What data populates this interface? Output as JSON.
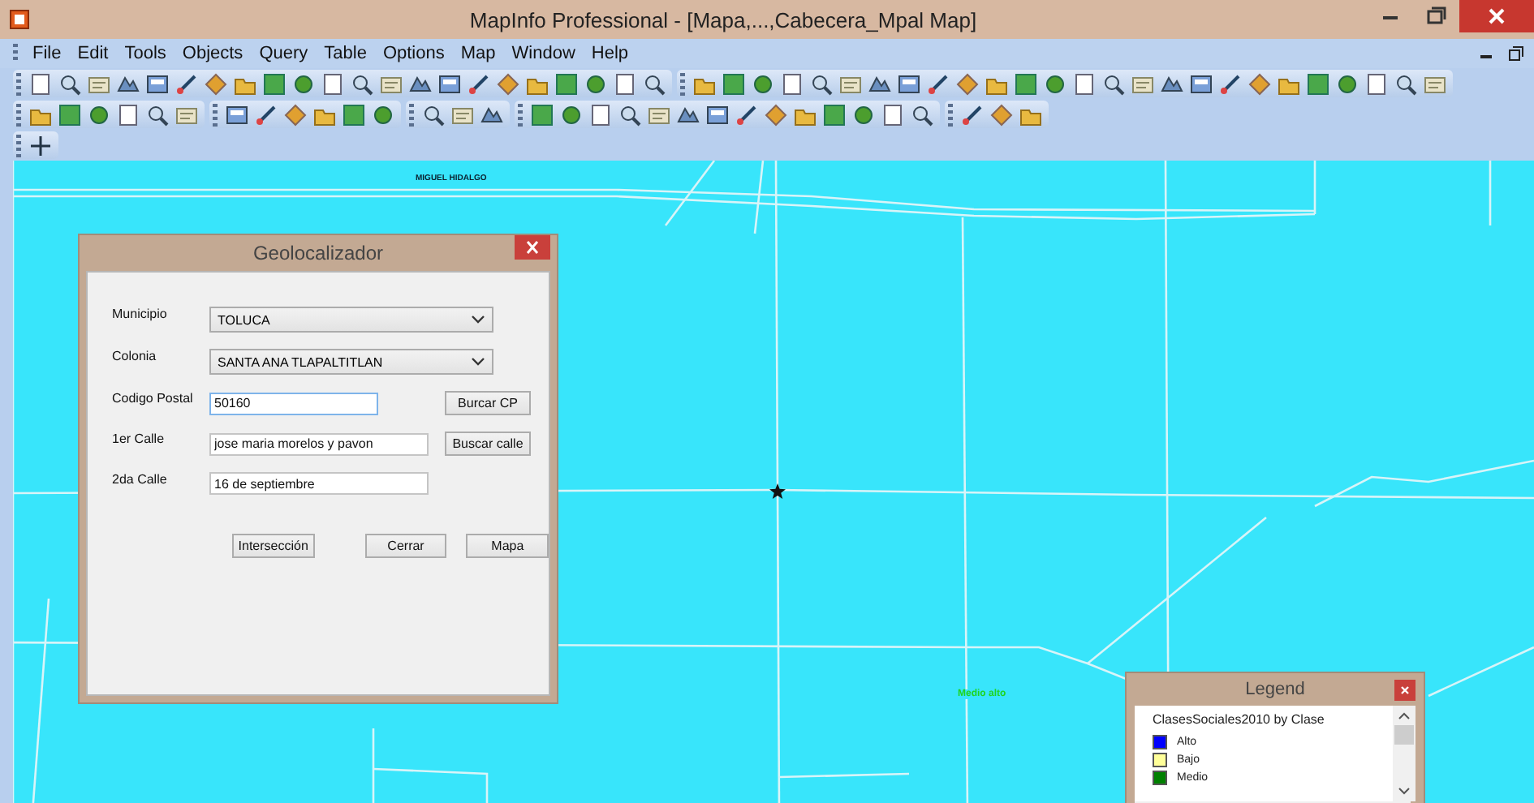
{
  "window": {
    "title": "MapInfo Professional - [Mapa,...,Cabecera_Mpal Map]"
  },
  "menu": [
    {
      "label": "File"
    },
    {
      "label": "Edit"
    },
    {
      "label": "Tools"
    },
    {
      "label": "Objects"
    },
    {
      "label": "Query"
    },
    {
      "label": "Table"
    },
    {
      "label": "Options"
    },
    {
      "label": "Map"
    },
    {
      "label": "Window"
    },
    {
      "label": "Help"
    }
  ],
  "map_labels": [
    {
      "text": "MIGUEL HIDALGO",
      "kind": "street"
    },
    {
      "text": "Medio alto",
      "kind": "class"
    }
  ],
  "dialog": {
    "title": "Geolocalizador",
    "rows": [
      {
        "label": "Municipio",
        "kind": "select",
        "value": "TOLUCA"
      },
      {
        "label": "Colonia",
        "kind": "select",
        "value": "SANTA ANA TLAPALTITLAN"
      },
      {
        "label": "Codigo Postal",
        "kind": "input",
        "value": "50160",
        "focused": true,
        "button": "Burcar CP"
      },
      {
        "label": "1er Calle",
        "kind": "input",
        "value": "jose maria morelos y pavon",
        "focused": false,
        "button": "Buscar calle"
      },
      {
        "label": "2da Calle",
        "kind": "input",
        "value": "16 de septiembre",
        "focused": false
      }
    ],
    "buttons": [
      "Intersección",
      "Cerrar",
      "Mapa"
    ]
  },
  "legend": {
    "title": "Legend",
    "layer": "ClasesSociales2010 by Clase",
    "items": [
      {
        "label": "Alto",
        "color": "#0000ff"
      },
      {
        "label": "Bajo",
        "color": "#ffff99"
      },
      {
        "label": "Medio",
        "color": "#008000"
      }
    ]
  }
}
